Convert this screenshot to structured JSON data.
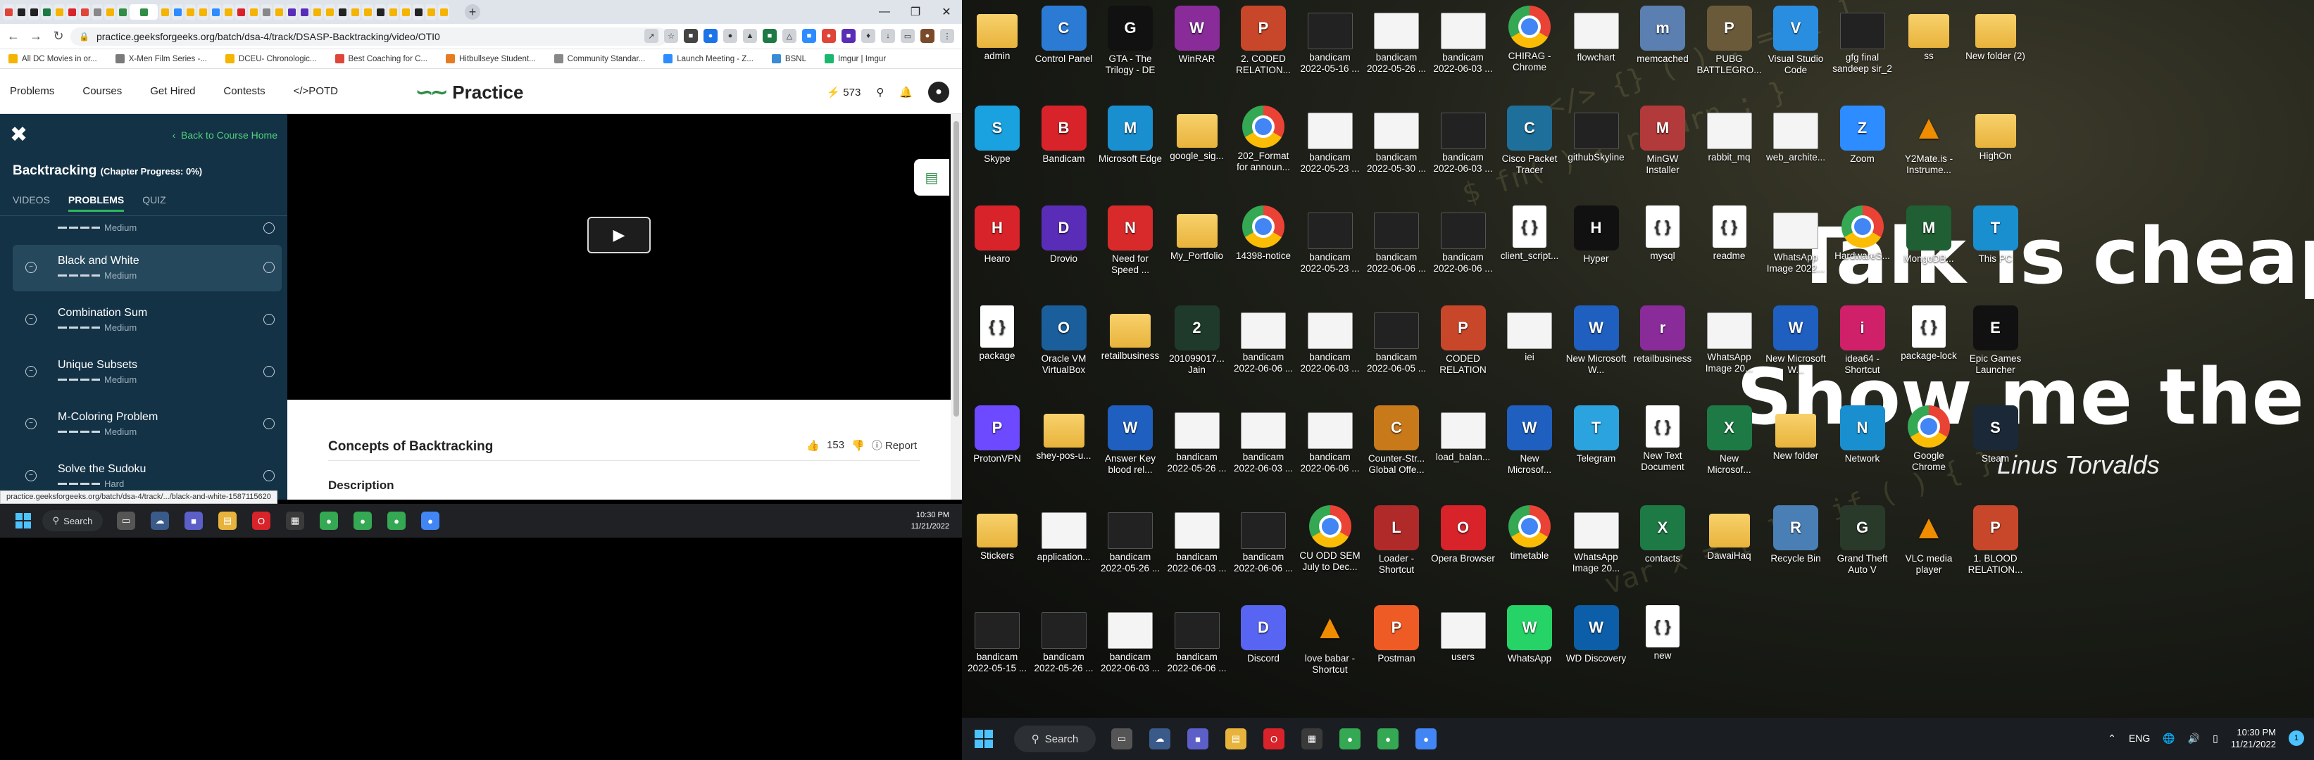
{
  "browser": {
    "address": "practice.geeksforgeeks.org/batch/dsa-4/track/DSASP-Backtracking/video/OTI0",
    "bookmarks": [
      {
        "label": "All DC Movies in or...",
        "color": "#f5b400"
      },
      {
        "label": "X-Men Film Series -...",
        "color": "#7a7a7a"
      },
      {
        "label": "DCEU- Chronologic...",
        "color": "#f5b400"
      },
      {
        "label": "Best Coaching for C...",
        "color": "#e0453a"
      },
      {
        "label": "Hitbullseye Student...",
        "color": "#e57c22"
      },
      {
        "label": "Community Standar...",
        "color": "#888888"
      },
      {
        "label": "Launch Meeting - Z...",
        "color": "#2d8cff"
      },
      {
        "label": "BSNL",
        "color": "#3a8ad4"
      },
      {
        "label": "Imgur | Imgur",
        "color": "#1bb76e"
      }
    ],
    "status_url": "practice.geeksforgeeks.org/batch/dsa-4/track/.../black-and-white-1587115620"
  },
  "gfg": {
    "nav": [
      "Problems",
      "Courses",
      "Get Hired",
      "Contests",
      "</>POTD"
    ],
    "logo_text": "Practice",
    "streak": "573",
    "back_home": "Back to Course Home",
    "chapter_title": "Backtracking",
    "chapter_progress": "(Chapter Progress: 0%)",
    "tabs": [
      "VIDEOS",
      "PROBLEMS",
      "QUIZ"
    ],
    "problems": [
      {
        "name": "Black and White",
        "difficulty": "Medium"
      },
      {
        "name": "Combination Sum",
        "difficulty": "Medium"
      },
      {
        "name": "Unique Subsets",
        "difficulty": "Medium"
      },
      {
        "name": "M-Coloring Problem",
        "difficulty": "Medium"
      },
      {
        "name": "Solve the Sudoku",
        "difficulty": "Hard"
      }
    ],
    "partial_problem_difficulty": "Medium",
    "lecture_title": "Concepts of Backtracking",
    "likes": "153",
    "report": "Report",
    "description": "Description"
  },
  "left_taskbar": {
    "search": "Search",
    "time": "10:30 PM",
    "date": "11/21/2022"
  },
  "desktop": {
    "quote_line1": "Talk is cheap.",
    "quote_line2": "Show me the code.",
    "quote_author": "Linus Torvalds",
    "icons": [
      {
        "label": "admin",
        "type": "folder"
      },
      {
        "label": "Control Panel",
        "type": "app",
        "color": "#2b7bd4"
      },
      {
        "label": "GTA - The Trilogy - DE",
        "type": "app",
        "color": "#111111"
      },
      {
        "label": "WinRAR",
        "type": "app",
        "color": "#8a2b9a"
      },
      {
        "label": "2. CODED RELATION...",
        "type": "ppt"
      },
      {
        "label": "bandicam 2022-05-16 ...",
        "type": "thumbdark"
      },
      {
        "label": "bandicam 2022-05-26 ...",
        "type": "thumb"
      },
      {
        "label": "bandicam 2022-06-03 ...",
        "type": "thumb"
      },
      {
        "label": "CHIRAG - Chrome",
        "type": "chrome"
      },
      {
        "label": "flowchart",
        "type": "thumb"
      },
      {
        "label": "memcached",
        "type": "app",
        "color": "#5a7fb0"
      },
      {
        "label": "PUBG BATTLEGRO...",
        "type": "app",
        "color": "#6b5a3a"
      },
      {
        "label": "Visual Studio Code",
        "type": "app",
        "color": "#2a8ee0"
      },
      {
        "label": "gfg final sandeep sir_2",
        "type": "thumbdark"
      },
      {
        "label": "ss",
        "type": "folder"
      },
      {
        "label": "New folder (2)",
        "type": "folder"
      },
      {
        "label": "Skype",
        "type": "app",
        "color": "#1aa1e0"
      },
      {
        "label": "Bandicam",
        "type": "app",
        "color": "#d8232a"
      },
      {
        "label": "Microsoft Edge",
        "type": "app",
        "color": "#1a8fcf"
      },
      {
        "label": "google_sig...",
        "type": "folder"
      },
      {
        "label": "202_Format for announ...",
        "type": "chrome"
      },
      {
        "label": "bandicam 2022-05-23 ...",
        "type": "thumb"
      },
      {
        "label": "bandicam 2022-05-30 ...",
        "type": "thumb"
      },
      {
        "label": "bandicam 2022-06-03 ...",
        "type": "thumbdark"
      },
      {
        "label": "Cisco Packet Tracer",
        "type": "app",
        "color": "#1e6f9a"
      },
      {
        "label": "githubSkyline",
        "type": "thumbdark"
      },
      {
        "label": "MinGW Installer",
        "type": "app",
        "color": "#b33a3a"
      },
      {
        "label": "rabbit_mq",
        "type": "thumb"
      },
      {
        "label": "web_archite...",
        "type": "thumb"
      },
      {
        "label": "Zoom",
        "type": "app",
        "color": "#2d8cff"
      },
      {
        "label": "Y2Mate.is - Instrume...",
        "type": "cone"
      },
      {
        "label": "HighOn",
        "type": "folder"
      },
      {
        "label": "Hearo",
        "type": "app",
        "color": "#d8232a"
      },
      {
        "label": "Drovio",
        "type": "app",
        "color": "#5a2db8"
      },
      {
        "label": "Need for Speed ...",
        "type": "app",
        "color": "#d82a2a"
      },
      {
        "label": "My_Portfolio",
        "type": "folder"
      },
      {
        "label": "14398-notice",
        "type": "chrome"
      },
      {
        "label": "bandicam 2022-05-23 ...",
        "type": "thumbdark"
      },
      {
        "label": "bandicam 2022-06-06 ...",
        "type": "thumbdark"
      },
      {
        "label": "bandicam 2022-06-06 ...",
        "type": "thumbdark"
      },
      {
        "label": "client_script...",
        "type": "doc"
      },
      {
        "label": "Hyper",
        "type": "app",
        "color": "#111111"
      },
      {
        "label": "mysql",
        "type": "doc"
      },
      {
        "label": "readme",
        "type": "doc"
      },
      {
        "label": "WhatsApp Image 2022...",
        "type": "thumb"
      },
      {
        "label": "HardwareS...",
        "type": "chrome"
      },
      {
        "label": "MongoDB...",
        "type": "app",
        "color": "#1f5f33"
      },
      {
        "label": "This PC",
        "type": "app",
        "color": "#1a8fcf"
      },
      {
        "label": "package",
        "type": "doc"
      },
      {
        "label": "Oracle VM VirtualBox",
        "type": "app",
        "color": "#1b5e9c"
      },
      {
        "label": "retailbusiness",
        "type": "folder"
      },
      {
        "label": "201099017... Jain",
        "type": "app",
        "color": "#1f3a2a"
      },
      {
        "label": "bandicam 2022-06-06 ...",
        "type": "thumb"
      },
      {
        "label": "bandicam 2022-06-03 ...",
        "type": "thumb"
      },
      {
        "label": "bandicam 2022-06-05 ...",
        "type": "thumbdark"
      },
      {
        "label": "CODED RELATION",
        "type": "ppt"
      },
      {
        "label": "iei",
        "type": "thumb"
      },
      {
        "label": "New Microsoft W...",
        "type": "word"
      },
      {
        "label": "retailbusiness",
        "type": "app",
        "color": "#8a2b9a"
      },
      {
        "label": "WhatsApp Image 20...",
        "type": "thumb"
      },
      {
        "label": "New Microsoft W...",
        "type": "word"
      },
      {
        "label": "idea64 - Shortcut",
        "type": "app",
        "color": "#d0206a"
      },
      {
        "label": "package-lock",
        "type": "doc"
      },
      {
        "label": "Epic Games Launcher",
        "type": "app",
        "color": "#111111"
      },
      {
        "label": "ProtonVPN",
        "type": "app",
        "color": "#6d4aff"
      },
      {
        "label": "shey-pos-u...",
        "type": "folder"
      },
      {
        "label": "Answer Key blood rel...",
        "type": "word"
      },
      {
        "label": "bandicam 2022-05-26 ...",
        "type": "thumb"
      },
      {
        "label": "bandicam 2022-06-03 ...",
        "type": "thumb"
      },
      {
        "label": "bandicam 2022-06-06 ...",
        "type": "thumb"
      },
      {
        "label": "Counter-Str... Global Offe...",
        "type": "app",
        "color": "#c8791a"
      },
      {
        "label": "load_balan...",
        "type": "thumb"
      },
      {
        "label": "New Microsof...",
        "type": "word"
      },
      {
        "label": "Telegram",
        "type": "app",
        "color": "#2aa3de"
      },
      {
        "label": "New Text Document",
        "type": "doc"
      },
      {
        "label": "New Microsof...",
        "type": "excel"
      },
      {
        "label": "New folder",
        "type": "folder"
      },
      {
        "label": "Network",
        "type": "app",
        "color": "#1a8fcf"
      },
      {
        "label": "Google Chrome",
        "type": "chrome"
      },
      {
        "label": "Steam",
        "type": "app",
        "color": "#1b2838"
      },
      {
        "label": "Stickers",
        "type": "folder"
      },
      {
        "label": "application...",
        "type": "thumb"
      },
      {
        "label": "bandicam 2022-05-26 ...",
        "type": "thumbdark"
      },
      {
        "label": "bandicam 2022-06-03 ...",
        "type": "thumb"
      },
      {
        "label": "bandicam 2022-06-06 ...",
        "type": "thumbdark"
      },
      {
        "label": "CU ODD SEM July to Dec...",
        "type": "chrome"
      },
      {
        "label": "Loader - Shortcut",
        "type": "app",
        "color": "#b02a2a"
      },
      {
        "label": "Opera Browser",
        "type": "app",
        "color": "#d8232a"
      },
      {
        "label": "timetable",
        "type": "chrome"
      },
      {
        "label": "WhatsApp Image 20...",
        "type": "thumb"
      },
      {
        "label": "contacts",
        "type": "excel"
      },
      {
        "label": "DawaiHaq",
        "type": "folder"
      },
      {
        "label": "Recycle Bin",
        "type": "app",
        "color": "#4a7fb5"
      },
      {
        "label": "Grand Theft Auto V",
        "type": "app",
        "color": "#2a3a2a"
      },
      {
        "label": "VLC media player",
        "type": "cone"
      },
      {
        "label": "1. BLOOD RELATION...",
        "type": "ppt"
      },
      {
        "label": "bandicam 2022-05-15 ...",
        "type": "thumbdark"
      },
      {
        "label": "bandicam 2022-05-26 ...",
        "type": "thumbdark"
      },
      {
        "label": "bandicam 2022-06-03 ...",
        "type": "thumb"
      },
      {
        "label": "bandicam 2022-06-06 ...",
        "type": "thumbdark"
      },
      {
        "label": "Discord",
        "type": "app",
        "color": "#5865f2"
      },
      {
        "label": "love babar - Shortcut",
        "type": "cone"
      },
      {
        "label": "Postman",
        "type": "app",
        "color": "#ef5b25"
      },
      {
        "label": "users",
        "type": "thumb"
      },
      {
        "label": "WhatsApp",
        "type": "app",
        "color": "#25d366"
      },
      {
        "label": "WD Discovery",
        "type": "app",
        "color": "#0c5ea8"
      },
      {
        "label": "new",
        "type": "doc"
      }
    ]
  },
  "right_taskbar": {
    "search": "Search",
    "lang": "ENG",
    "time": "10:30 PM",
    "date": "11/21/2022",
    "notif_count": "1"
  }
}
